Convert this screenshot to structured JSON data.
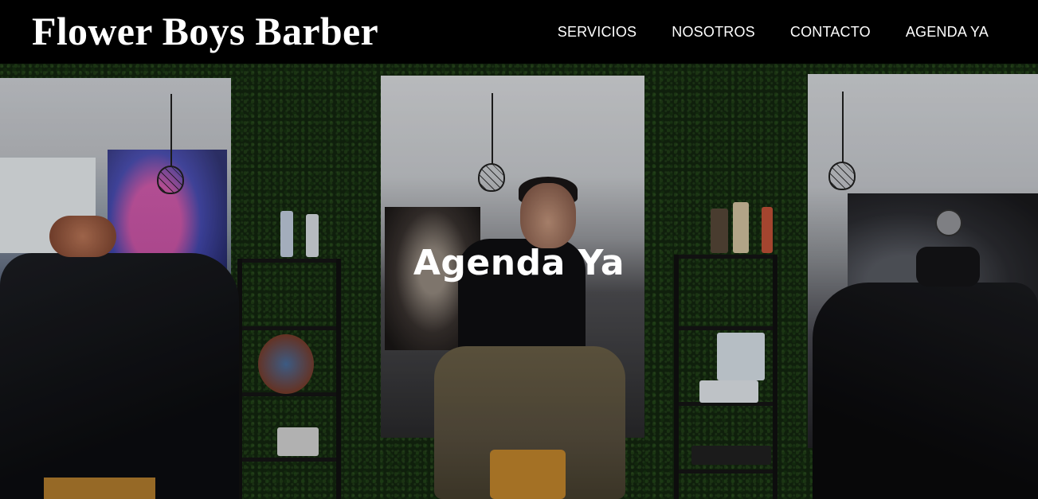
{
  "header": {
    "brand": "Flower Boys Barber",
    "nav": [
      {
        "label": "SERVICIOS"
      },
      {
        "label": "NOSOTROS"
      },
      {
        "label": "CONTACTO"
      },
      {
        "label": "AGENDA YA"
      }
    ]
  },
  "hero": {
    "title": "Agenda Ya",
    "image": "barbershop-interior-photo"
  },
  "colors": {
    "header_bg": "#000000",
    "text": "#ffffff",
    "wall": "#13260f"
  }
}
